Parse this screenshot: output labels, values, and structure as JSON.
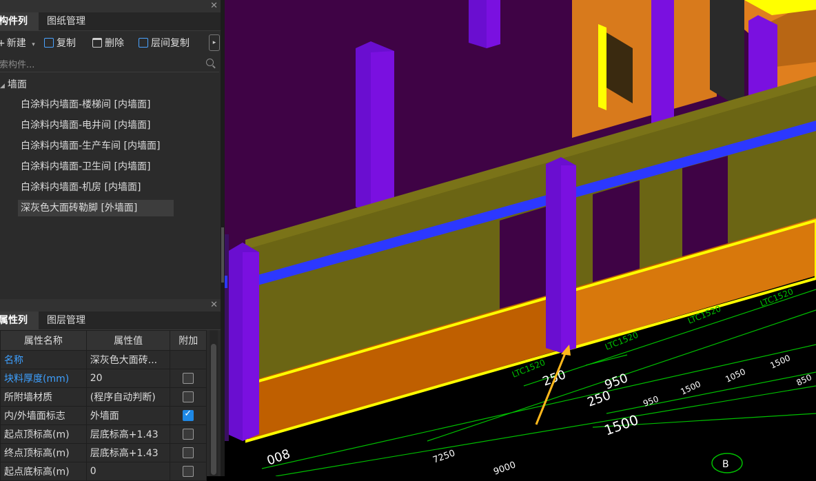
{
  "top_panel": {
    "tabs": [
      "构件列表",
      "图纸管理"
    ],
    "toolbar": {
      "new": "新建",
      "copy": "复制",
      "delete": "删除",
      "floor_copy": "层间复制"
    },
    "search_placeholder": "搜索构件...",
    "tree_root": "墙面",
    "items": [
      "白涂料内墙面-楼梯间 [内墙面]",
      "白涂料内墙面-电井间 [内墙面]",
      "白涂料内墙面-生产车间 [内墙面]",
      "白涂料内墙面-卫生间 [内墙面]",
      "白涂料内墙面-机房 [内墙面]",
      "深灰色大面砖勒脚 [外墙面]"
    ],
    "selected_index": 5
  },
  "bottom_panel": {
    "tabs": [
      "属性列表",
      "图层管理"
    ],
    "columns": [
      "属性名称",
      "属性值",
      "附加"
    ],
    "rows": [
      {
        "name": "名称",
        "value": "深灰色大面砖...",
        "checkbox": "none",
        "highlight": true
      },
      {
        "name": "块料厚度(mm)",
        "value": "20",
        "checkbox": "off",
        "highlight": true
      },
      {
        "name": "所附墙材质",
        "value": "(程序自动判断)",
        "checkbox": "off",
        "highlight": false
      },
      {
        "name": "内/外墙面标志",
        "value": "外墙面",
        "checkbox": "on",
        "highlight": false
      },
      {
        "name": "起点顶标高(m)",
        "value": "层底标高+1.43",
        "checkbox": "off",
        "highlight": false
      },
      {
        "name": "终点顶标高(m)",
        "value": "层底标高+1.43",
        "checkbox": "off",
        "highlight": false
      },
      {
        "name": "起点底标高(m)",
        "value": "0",
        "checkbox": "off",
        "highlight": false
      }
    ]
  },
  "viewport": {
    "window_labels": [
      "LTC1520",
      "LTC1520",
      "LTC1520",
      "LTC1520"
    ],
    "dimensions": [
      "250",
      "950",
      "250",
      "950",
      "1500",
      "1050",
      "1500",
      "850",
      "1500",
      "7250",
      "9000",
      "008"
    ],
    "axis_label": "B",
    "colors": {
      "background": "#000000",
      "wall_olive": "#6b6514",
      "skirting_orange": "#bf5f00",
      "column_purple": "#7a10e0",
      "beam_blue": "#2c38ff",
      "wall_dark_purple": "#3f0345",
      "outline_yellow": "#ffff00",
      "dimension_green": "#00c800",
      "arrow": "#ffb81c"
    }
  }
}
